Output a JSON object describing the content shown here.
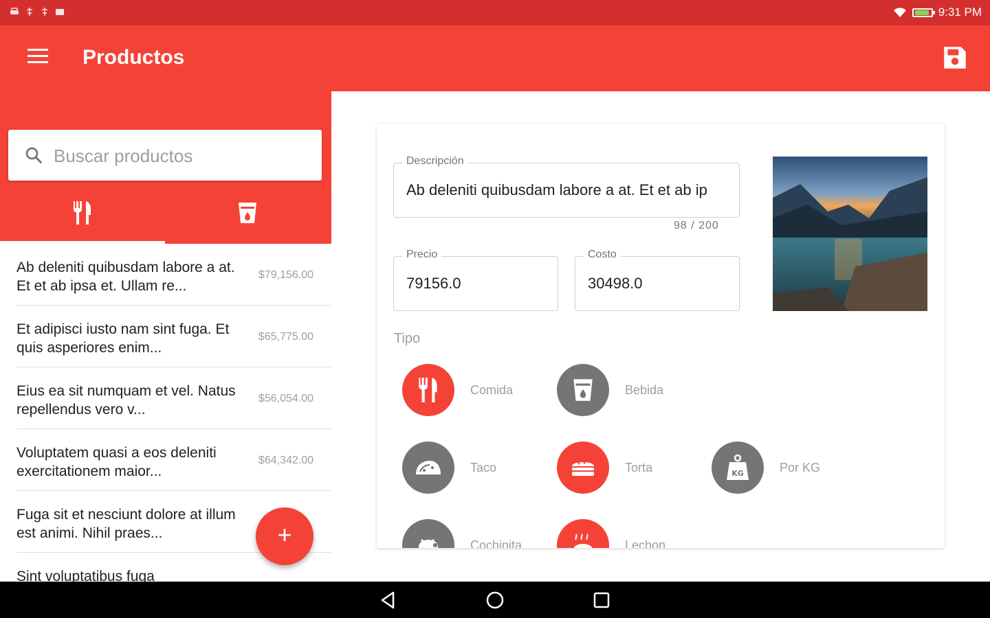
{
  "status_bar": {
    "time": "9:31 PM"
  },
  "app_bar": {
    "title": "Productos"
  },
  "search": {
    "placeholder": "Buscar productos",
    "value": ""
  },
  "tabs": [
    {
      "icon": "fork-knife-icon",
      "active": true
    },
    {
      "icon": "cup-icon",
      "active": false
    }
  ],
  "products": [
    {
      "name": "Ab deleniti quibusdam labore a at. Et et ab ipsa et. Ullam re...",
      "price": "$79,156.00"
    },
    {
      "name": "Et adipisci iusto nam sint fuga. Et quis asperiores enim...",
      "price": "$65,775.00"
    },
    {
      "name": "Eius ea sit numquam et vel. Natus repellendus vero v...",
      "price": "$56,054.00"
    },
    {
      "name": "Voluptatem quasi a eos deleniti exercitationem maior...",
      "price": "$64,342.00"
    },
    {
      "name": "Fuga sit et nesciunt dolore at illum est animi. Nihil praes...",
      "price": ""
    },
    {
      "name": "Sint voluptatibus fuga",
      "price": ""
    }
  ],
  "fab": {
    "label": "+"
  },
  "form": {
    "description_label": "Descripción",
    "description_value": "Ab deleniti quibusdam labore a at. Et et ab ip",
    "counter": "98 / 200",
    "price_label": "Precio",
    "price_value": "79156.0",
    "cost_label": "Costo",
    "cost_value": "30498.0",
    "type_label": "Tipo"
  },
  "types": [
    {
      "label": "Comida",
      "icon": "fork-knife-icon",
      "selected": true
    },
    {
      "label": "Bebida",
      "icon": "cup-icon",
      "selected": false
    },
    {
      "label": "Taco",
      "icon": "taco-icon",
      "selected": false
    },
    {
      "label": "Torta",
      "icon": "sandwich-icon",
      "selected": true
    },
    {
      "label": "Por KG",
      "icon": "weight-icon",
      "selected": false
    },
    {
      "label": "Cochinita",
      "icon": "pig-icon",
      "selected": false
    },
    {
      "label": "Lechon",
      "icon": "roast-icon",
      "selected": true
    }
  ],
  "colors": {
    "primary": "#f44336",
    "primary_dark": "#d32f2f",
    "unselected": "#757575",
    "divider": "#e0e0e0"
  }
}
